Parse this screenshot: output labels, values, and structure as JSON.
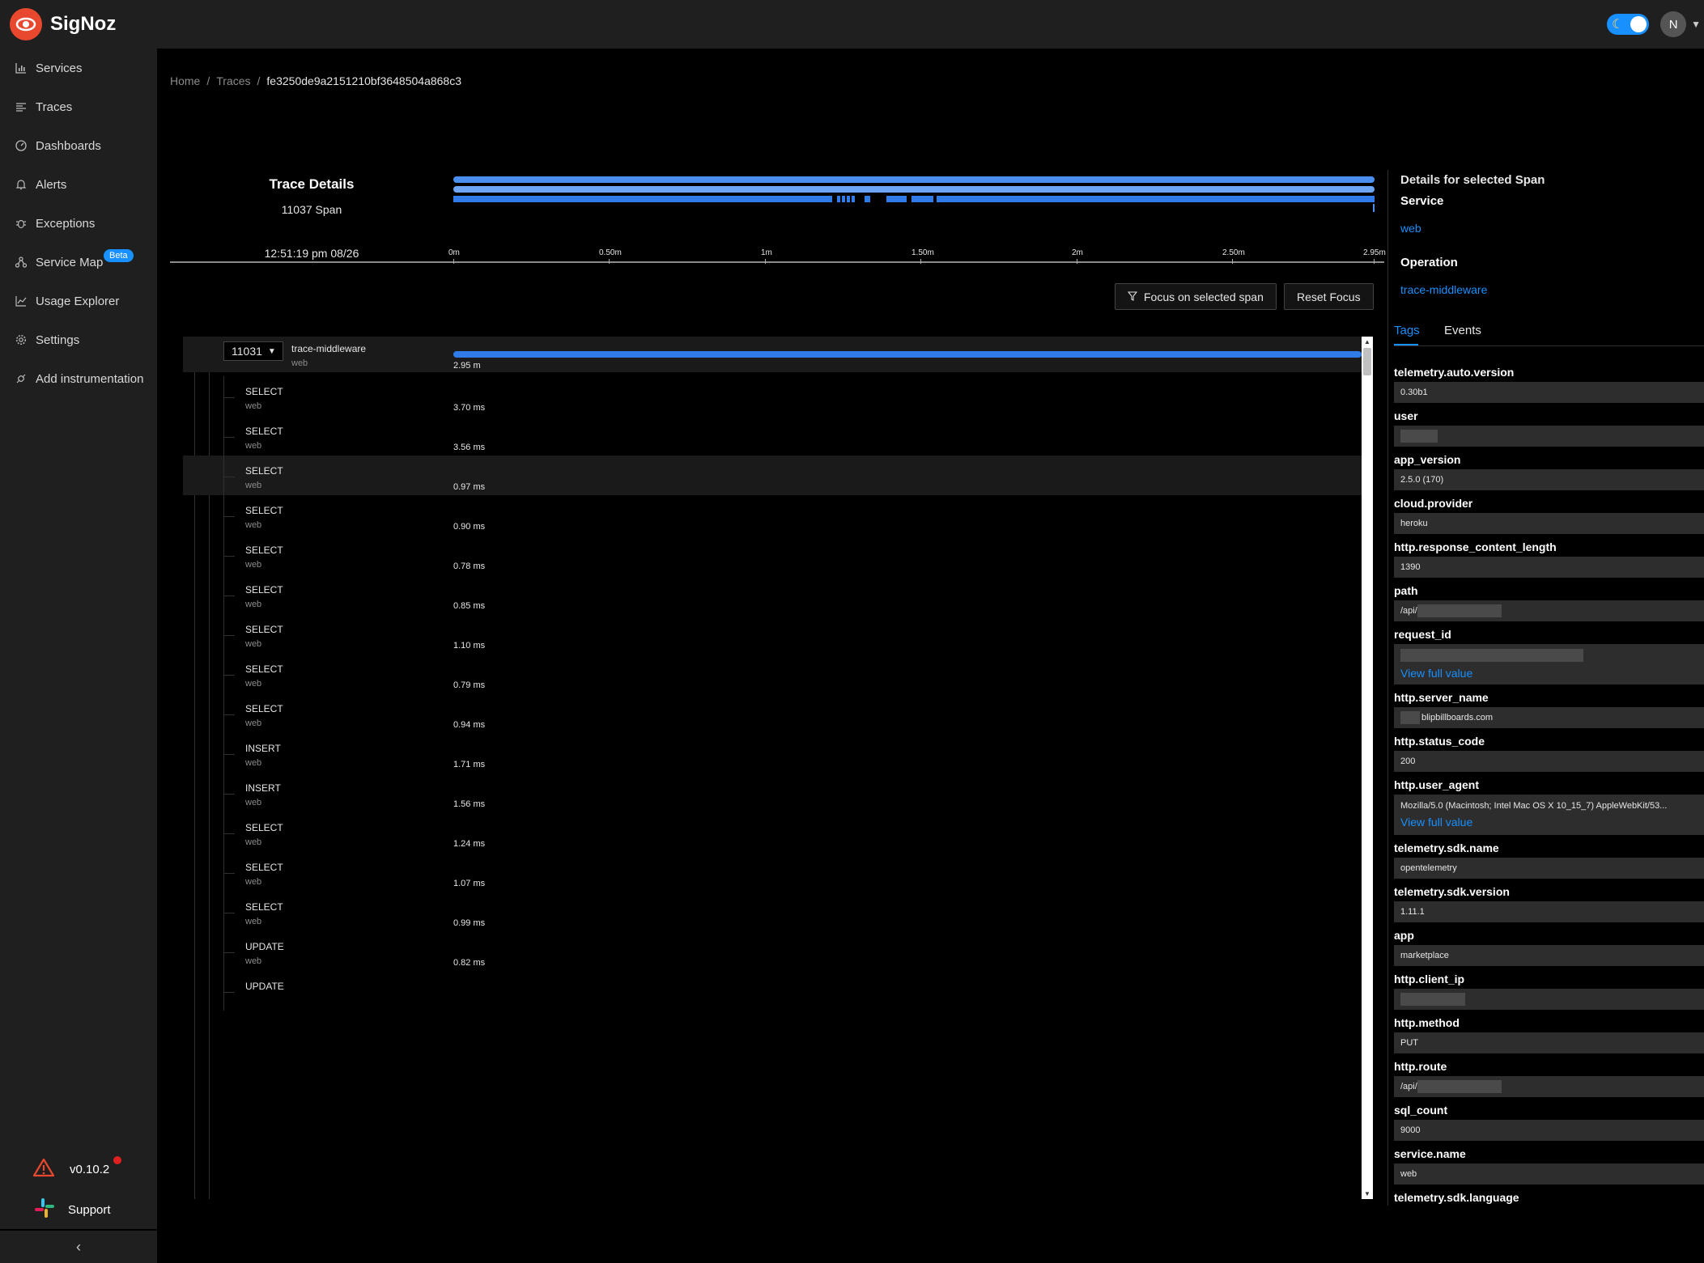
{
  "app": {
    "name": "SigNoz"
  },
  "header": {
    "avatar_initial": "N"
  },
  "sidebar": {
    "items": [
      {
        "label": "Services",
        "icon": "bar-chart-icon"
      },
      {
        "label": "Traces",
        "icon": "align-left-icon"
      },
      {
        "label": "Dashboards",
        "icon": "dashboard-icon"
      },
      {
        "label": "Alerts",
        "icon": "bell-icon"
      },
      {
        "label": "Exceptions",
        "icon": "bug-icon"
      },
      {
        "label": "Service Map",
        "icon": "deployment-icon",
        "badge": "Beta"
      },
      {
        "label": "Usage Explorer",
        "icon": "line-chart-icon"
      },
      {
        "label": "Settings",
        "icon": "gear-icon"
      },
      {
        "label": "Add instrumentation",
        "icon": "api-icon"
      }
    ],
    "version": "v0.10.2",
    "support": "Support"
  },
  "breadcrumb": {
    "home": "Home",
    "traces": "Traces",
    "trace_id": "fe3250de9a2151210bf3648504a868c3"
  },
  "trace": {
    "title": "Trace Details",
    "span_count": "11037 Span",
    "start_time": "12:51:19 pm 08/26",
    "ticks": [
      "0m",
      "0.50m",
      "1m",
      "1.50m",
      "2m",
      "2.50m",
      "2.95m"
    ]
  },
  "actions": {
    "focus": "Focus on selected span",
    "reset": "Reset Focus"
  },
  "tree": {
    "root": {
      "children_count": "11031",
      "name": "trace-middleware",
      "service": "web",
      "duration": "2.95 m"
    },
    "spans": [
      {
        "name": "SELECT",
        "service": "web",
        "duration": "3.70 ms"
      },
      {
        "name": "SELECT",
        "service": "web",
        "duration": "3.56 ms"
      },
      {
        "name": "SELECT",
        "service": "web",
        "duration": "0.97 ms"
      },
      {
        "name": "SELECT",
        "service": "web",
        "duration": "0.90 ms"
      },
      {
        "name": "SELECT",
        "service": "web",
        "duration": "0.78 ms"
      },
      {
        "name": "SELECT",
        "service": "web",
        "duration": "0.85 ms"
      },
      {
        "name": "SELECT",
        "service": "web",
        "duration": "1.10 ms"
      },
      {
        "name": "SELECT",
        "service": "web",
        "duration": "0.79 ms"
      },
      {
        "name": "SELECT",
        "service": "web",
        "duration": "0.94 ms"
      },
      {
        "name": "INSERT",
        "service": "web",
        "duration": "1.71 ms"
      },
      {
        "name": "INSERT",
        "service": "web",
        "duration": "1.56 ms"
      },
      {
        "name": "SELECT",
        "service": "web",
        "duration": "1.24 ms"
      },
      {
        "name": "SELECT",
        "service": "web",
        "duration": "1.07 ms"
      },
      {
        "name": "SELECT",
        "service": "web",
        "duration": "0.99 ms"
      },
      {
        "name": "UPDATE",
        "service": "web",
        "duration": "0.82 ms"
      },
      {
        "name": "UPDATE",
        "service": "",
        "duration": ""
      }
    ]
  },
  "details": {
    "heading": "Details for selected Span",
    "service_label": "Service",
    "service_value": "web",
    "operation_label": "Operation",
    "operation_value": "trace-middleware",
    "tabs": [
      "Tags",
      "Events"
    ],
    "view_full": "View full value",
    "tags": [
      {
        "key": "telemetry.auto.version",
        "value": "0.30b1"
      },
      {
        "key": "user",
        "value": ""
      },
      {
        "key": "app_version",
        "value": "2.5.0 (170)"
      },
      {
        "key": "cloud.provider",
        "value": "heroku"
      },
      {
        "key": "http.response_content_length",
        "value": "1390"
      },
      {
        "key": "path",
        "value": "/api/"
      },
      {
        "key": "request_id",
        "value": ""
      },
      {
        "key": "http.server_name",
        "value": "blipbillboards.com"
      },
      {
        "key": "http.status_code",
        "value": "200"
      },
      {
        "key": "http.user_agent",
        "value": "Mozilla/5.0 (Macintosh; Intel Mac OS X 10_15_7) AppleWebKit/53..."
      },
      {
        "key": "telemetry.sdk.name",
        "value": "opentelemetry"
      },
      {
        "key": "telemetry.sdk.version",
        "value": "1.11.1"
      },
      {
        "key": "app",
        "value": "marketplace"
      },
      {
        "key": "http.client_ip",
        "value": ""
      },
      {
        "key": "http.method",
        "value": "PUT"
      },
      {
        "key": "http.route",
        "value": "/api/"
      },
      {
        "key": "sql_count",
        "value": "9000"
      },
      {
        "key": "service.name",
        "value": "web"
      },
      {
        "key": "telemetry.sdk.language",
        "value": ""
      }
    ]
  }
}
